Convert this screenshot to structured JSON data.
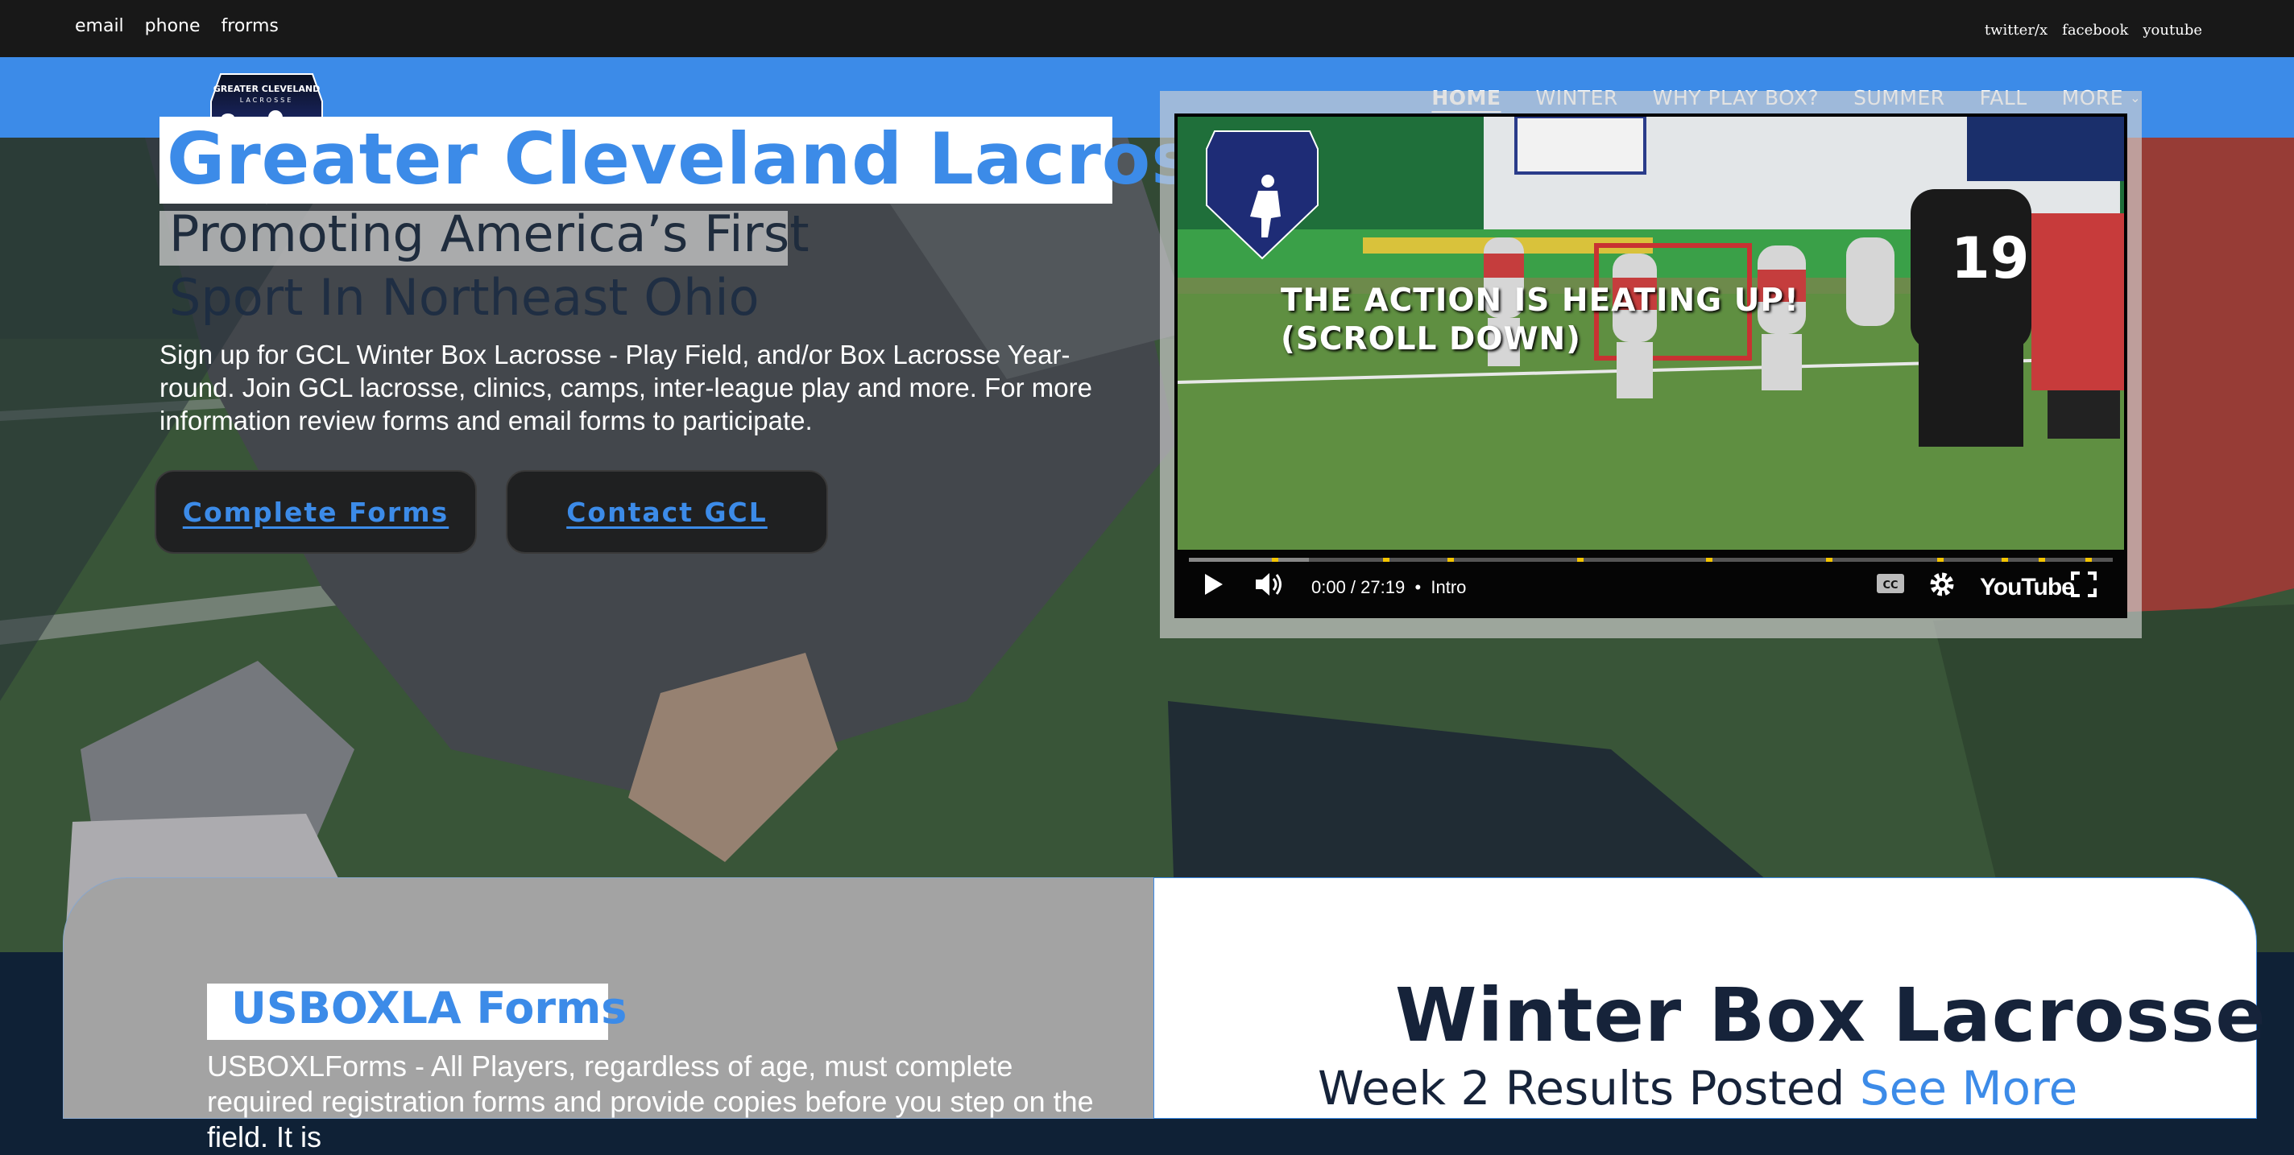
{
  "topbar": {
    "left_links": [
      "email",
      "phone",
      "frorms"
    ],
    "right_links": [
      "twitter/x",
      "facebook",
      "youtube"
    ]
  },
  "nav": {
    "items": [
      {
        "label": "HOME",
        "active": true
      },
      {
        "label": "WINTER"
      },
      {
        "label": "WHY PLAY BOX?"
      },
      {
        "label": "SUMMER"
      },
      {
        "label": "FALL"
      },
      {
        "label": "MORE"
      }
    ]
  },
  "logo": {
    "line1": "GREATER CLEVELAND",
    "line2": "LACROSSE"
  },
  "hero": {
    "title": "Greater Cleveland Lacrosse",
    "subtitle_line1": "Promoting America’s First",
    "subtitle_line2": "Sport In Northeast Ohio",
    "description": "Sign up for GCL Winter Box Lacrosse - Play Field, and/or Box Lacrosse Year-round. Join GCL lacrosse, clinics, camps, inter-league play and more. For more information review forms and email forms to participate.",
    "button_forms": "Complete Forms",
    "button_contact": "Contact GCL"
  },
  "video": {
    "overlay_line1": "THE ACTION IS HEATING UP!",
    "overlay_line2": "(SCROLL DOWN)",
    "time": "0:00 / 27:19",
    "chapter": "Intro",
    "brand": "YouTube",
    "progress_played": 0.13,
    "chapter_marks": [
      0.09,
      0.21,
      0.28,
      0.42,
      0.56,
      0.69,
      0.81,
      0.88,
      0.92,
      0.97
    ]
  },
  "usbox": {
    "title": "USBOXLA Forms",
    "text": "USBOXLForms - All Players, regardless of age,  must complete required registration forms and provide copies before you step on the field. It is"
  },
  "winter": {
    "title": "Winter Box Lacrosse",
    "subtitle": "Week 2 Results Posted ",
    "link": "See More"
  },
  "colors": {
    "accent": "#3c8be8",
    "topbar": "#181818",
    "dark_navy": "#16233a",
    "button_bg": "#1f2021",
    "progress_marker": "#f3c400"
  }
}
